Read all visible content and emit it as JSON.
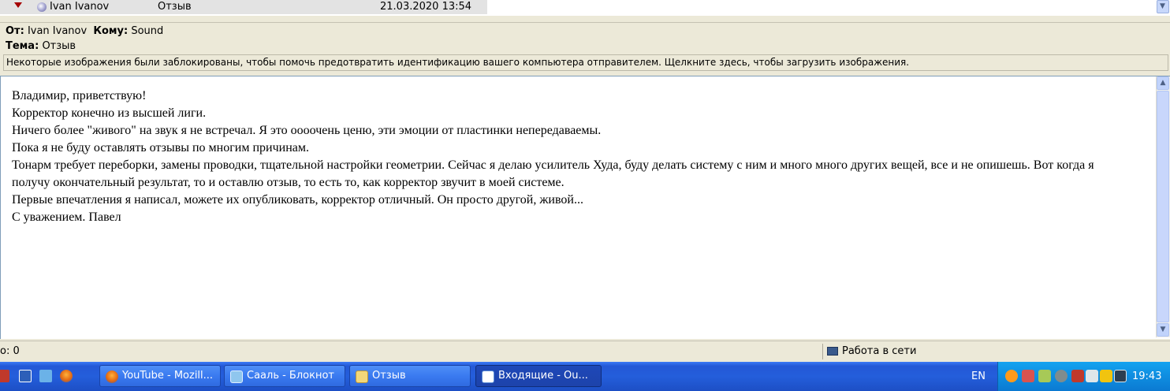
{
  "message_list": {
    "row": {
      "from": "Ivan Ivanov",
      "subject": "Отзыв",
      "date": "21.03.2020 13:54"
    }
  },
  "header": {
    "from_label": "От:",
    "from_value": "Ivan Ivanov",
    "to_label": "Кому:",
    "to_value": "Sound",
    "subject_label": "Тема:",
    "subject_value": "Отзыв",
    "blocked_notice": "Некоторые изображения были заблокированы, чтобы помочь предотвратить идентификацию вашего компьютера отправителем. Щелкните здесь, чтобы загрузить изображения."
  },
  "body": {
    "lines": [
      "Владимир, приветствую!",
      "Корректор конечно из высшей лиги.",
      "Ничего более \"живого\" на звук я не встречал. Я это оооочень ценю, эти эмоции от пластинки непередаваемы.",
      "Пока я не буду оставлять отзывы по многим причинам.",
      "Тонарм требует переборки, замены проводки, тщательной настройки геометрии. Сейчас я делаю усилитель Худа, буду делать систему с ним и много много других вещей, все и не опишешь. Вот когда я получу окончательный результат, то и оставлю отзыв, то есть то, как корректор звучит в моей системе.",
      "Первые впечатления я написал, можете их опубликовать, корректор отличный. Он просто другой, живой...",
      "С уважением. Павел"
    ]
  },
  "status_bar": {
    "left_text": "о: 0",
    "online_text": "Работа в сети"
  },
  "taskbar": {
    "buttons": [
      {
        "label": "YouTube - Mozill...",
        "icon": "firefox-icon"
      },
      {
        "label": "Сааль - Блокнот",
        "icon": "notepad-icon"
      },
      {
        "label": "Отзыв",
        "icon": "folder-icon"
      },
      {
        "label": "Входящие - Ou...",
        "icon": "outlook-express-icon"
      }
    ],
    "language": "EN",
    "clock": "19:43"
  },
  "colors": {
    "taskbar_blue": "#245edb",
    "tray_blue": "#0f8de0",
    "window_bg": "#ece9d8"
  }
}
